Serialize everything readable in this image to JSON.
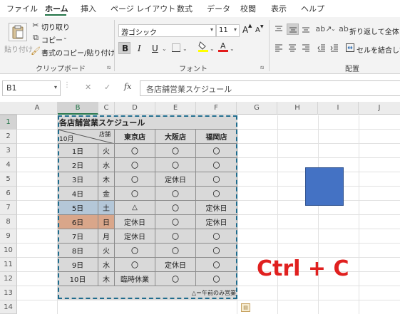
{
  "ribbon_tabs": [
    "ファイル",
    "ホーム",
    "挿入",
    "ページ レイアウト",
    "数式",
    "データ",
    "校閲",
    "表示",
    "ヘルプ"
  ],
  "active_tab": "ホーム",
  "clipboard": {
    "paste": "貼り付け",
    "cut": "切り取り",
    "copy": "コピー",
    "format_painter": "書式のコピー/貼り付け",
    "group_label": "クリップボード"
  },
  "font": {
    "font_name": "游ゴシック",
    "font_size": "11",
    "grow": "A",
    "shrink": "A",
    "bold": "B",
    "italic": "I",
    "underline": "U",
    "group_label": "フォント"
  },
  "alignment": {
    "wrap_text": "折り返して全体",
    "merge_center": "セルを結合して",
    "group_label": "配置"
  },
  "formula_bar": {
    "name_box": "B1",
    "cancel": "✕",
    "enter": "✓",
    "fx": "fx",
    "formula": "各店舗営業スケジュール"
  },
  "columns": [
    "A",
    "B",
    "C",
    "D",
    "E",
    "F",
    "G",
    "H",
    "I",
    "J"
  ],
  "selected_column": "B",
  "rows": [
    "1",
    "2",
    "3",
    "4",
    "5",
    "6",
    "7",
    "8",
    "9",
    "10",
    "11",
    "12",
    "13",
    "14"
  ],
  "selected_row": "1",
  "table": {
    "title": "各店舗営業スケジュール",
    "header_month": "10月",
    "header_store": "店舗",
    "stores": [
      "東京店",
      "大阪店",
      "福岡店"
    ],
    "rows": [
      {
        "day": "1日",
        "dow": "火",
        "tokyo": "〇",
        "osaka": "〇",
        "fukuoka": "〇",
        "hl": ""
      },
      {
        "day": "2日",
        "dow": "水",
        "tokyo": "〇",
        "osaka": "〇",
        "fukuoka": "〇",
        "hl": ""
      },
      {
        "day": "3日",
        "dow": "木",
        "tokyo": "〇",
        "osaka": "定休日",
        "fukuoka": "〇",
        "hl": ""
      },
      {
        "day": "4日",
        "dow": "金",
        "tokyo": "〇",
        "osaka": "〇",
        "fukuoka": "〇",
        "hl": ""
      },
      {
        "day": "5日",
        "dow": "土",
        "tokyo": "△",
        "osaka": "〇",
        "fukuoka": "定休日",
        "hl": "blue"
      },
      {
        "day": "6日",
        "dow": "日",
        "tokyo": "定休日",
        "osaka": "〇",
        "fukuoka": "定休日",
        "hl": "peach"
      },
      {
        "day": "7日",
        "dow": "月",
        "tokyo": "定休日",
        "osaka": "〇",
        "fukuoka": "〇",
        "hl": ""
      },
      {
        "day": "8日",
        "dow": "火",
        "tokyo": "〇",
        "osaka": "〇",
        "fukuoka": "〇",
        "hl": ""
      },
      {
        "day": "9日",
        "dow": "水",
        "tokyo": "〇",
        "osaka": "定休日",
        "fukuoka": "〇",
        "hl": ""
      },
      {
        "day": "10日",
        "dow": "木",
        "tokyo": "臨時休業",
        "osaka": "〇",
        "fukuoka": "〇",
        "hl": ""
      }
    ],
    "note": "△＝午前のみ営業"
  },
  "overlay_text": "Ctrl + C",
  "colors": {
    "accent": "#217346",
    "cell_fill": "#d9d9d9",
    "weekend_blue": "#b4c7d8",
    "weekend_peach": "#d9a68a",
    "shape_blue": "#4472c4",
    "overlay_red": "#e0201f",
    "marquee": "#1f6b8c"
  }
}
